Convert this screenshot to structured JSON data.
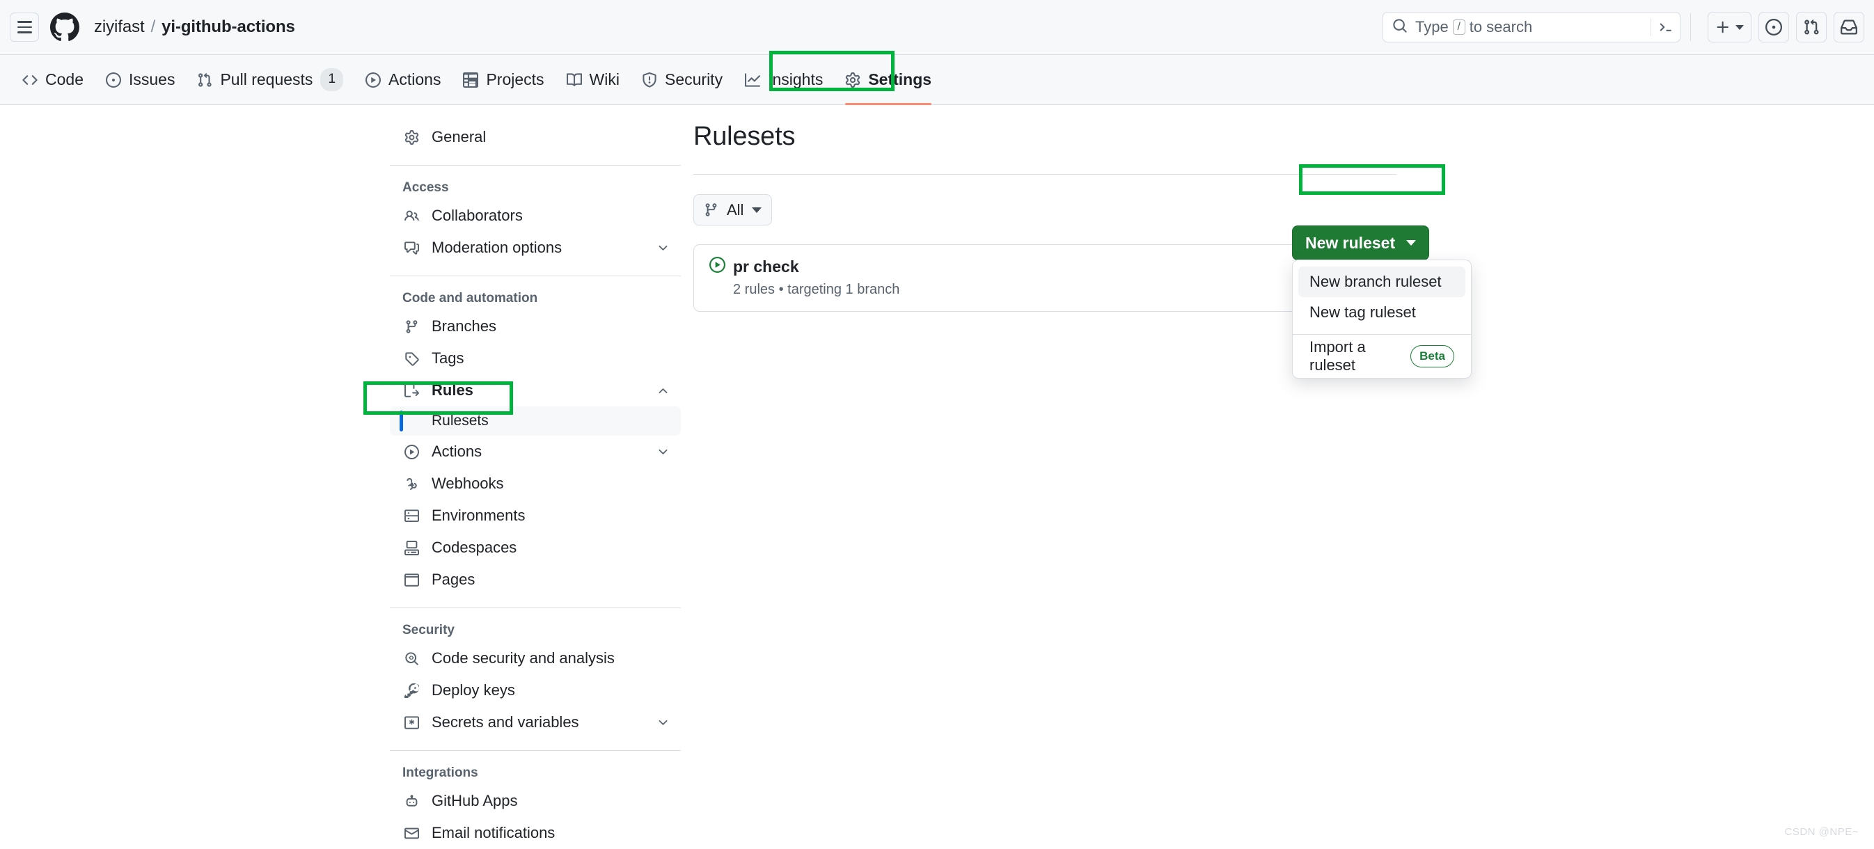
{
  "header": {
    "menu_label": "Open navigation menu",
    "owner": "ziyifast",
    "separator": "/",
    "repo": "yi-github-actions",
    "search_placeholder_pre": "Type",
    "search_key": "/",
    "search_placeholder_post": "to search",
    "create_new_label": "Create new...",
    "issues_label": "Your issues",
    "pulls_label": "Your pull requests",
    "inbox_label": "Notifications"
  },
  "repo_nav": {
    "items": [
      {
        "label": "Code",
        "icon": "code-icon",
        "count": ""
      },
      {
        "label": "Issues",
        "icon": "issue-opened-icon",
        "count": ""
      },
      {
        "label": "Pull requests",
        "icon": "git-pull-request-icon",
        "count": "1"
      },
      {
        "label": "Actions",
        "icon": "play-icon",
        "count": ""
      },
      {
        "label": "Projects",
        "icon": "table-icon",
        "count": ""
      },
      {
        "label": "Wiki",
        "icon": "book-icon",
        "count": ""
      },
      {
        "label": "Security",
        "icon": "shield-icon",
        "count": ""
      },
      {
        "label": "Insights",
        "icon": "graph-icon",
        "count": ""
      },
      {
        "label": "Settings",
        "icon": "gear-icon",
        "count": ""
      }
    ],
    "selected": "Settings"
  },
  "sidebar": {
    "general": {
      "label": "General",
      "icon": "gear-icon"
    },
    "sections": [
      {
        "title": "Access",
        "items": [
          {
            "label": "Collaborators",
            "icon": "people-icon",
            "expandable": false
          },
          {
            "label": "Moderation options",
            "icon": "comment-discussion-icon",
            "expandable": true
          }
        ]
      },
      {
        "title": "Code and automation",
        "items": [
          {
            "label": "Branches",
            "icon": "git-branch-icon",
            "expandable": false
          },
          {
            "label": "Tags",
            "icon": "tag-icon",
            "expandable": false
          },
          {
            "label": "Rules",
            "icon": "rules-icon",
            "expandable": true,
            "expanded": true,
            "bold": true,
            "children": [
              {
                "label": "Rulesets",
                "active": true
              }
            ]
          },
          {
            "label": "Actions",
            "icon": "play-icon",
            "expandable": true
          },
          {
            "label": "Webhooks",
            "icon": "webhook-icon",
            "expandable": false
          },
          {
            "label": "Environments",
            "icon": "server-icon",
            "expandable": false
          },
          {
            "label": "Codespaces",
            "icon": "codespaces-icon",
            "expandable": false
          },
          {
            "label": "Pages",
            "icon": "browser-icon",
            "expandable": false
          }
        ]
      },
      {
        "title": "Security",
        "items": [
          {
            "label": "Code security and analysis",
            "icon": "codescan-icon",
            "expandable": false
          },
          {
            "label": "Deploy keys",
            "icon": "key-icon",
            "expandable": false
          },
          {
            "label": "Secrets and variables",
            "icon": "asterisk-key-icon",
            "expandable": true
          }
        ]
      },
      {
        "title": "Integrations",
        "items": [
          {
            "label": "GitHub Apps",
            "icon": "github-app-icon",
            "expandable": false
          },
          {
            "label": "Email notifications",
            "icon": "mail-icon",
            "expandable": false
          }
        ]
      }
    ]
  },
  "main": {
    "title": "Rulesets",
    "filter": {
      "label": "All",
      "icon": "git-branch-icon"
    },
    "rulesets": [
      {
        "name": "pr check",
        "status_icon": "play-circle-icon",
        "meta": "2 rules • targeting 1 branch"
      }
    ]
  },
  "new_ruleset": {
    "button_label": "New ruleset",
    "menu": {
      "branch": "New branch ruleset",
      "tag": "New tag ruleset",
      "import": "Import a ruleset",
      "import_badge": "Beta"
    }
  },
  "annotations": {
    "color": "#00b33c",
    "targets": [
      "Settings",
      "Rulesets",
      "New branch ruleset"
    ]
  },
  "watermark": "CSDN @NPE~"
}
